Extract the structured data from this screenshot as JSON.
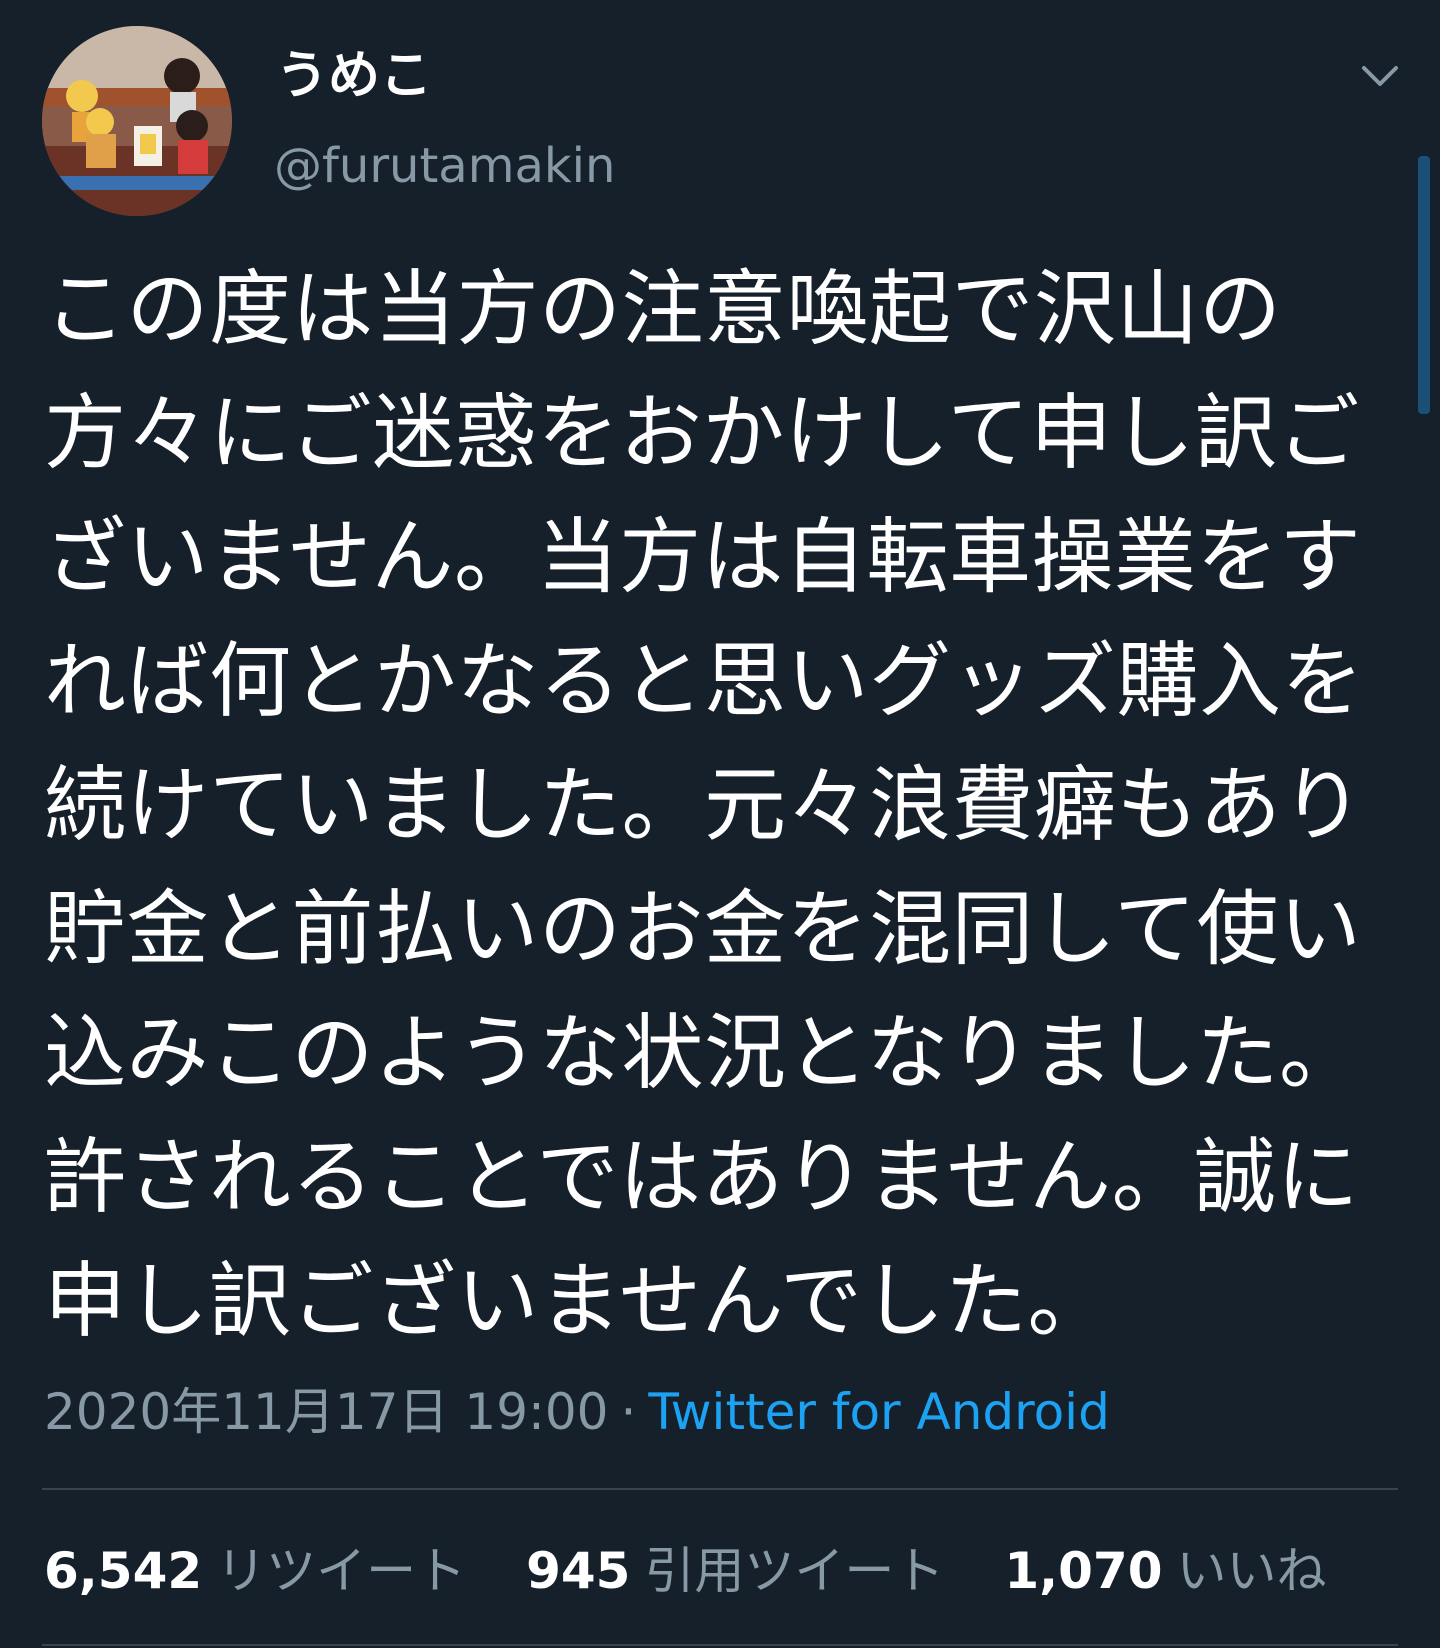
{
  "user": {
    "display_name": "うめこ",
    "handle": "@furutamakin"
  },
  "tweet": {
    "text": "この度は当方の注意喚起で沢山の方々にご迷惑をおかけして申し訳ございません。当方は自転車操業をすれば何とかなると思いグッズ購入を続けていました。元々浪費癖もあり貯金と前払いのお金を混同して使い込みこのような状況となりました。許されることではありません。誠に申し訳ございませんでした。",
    "timestamp": "2020年11月17日 19:00",
    "separator": "·",
    "source": "Twitter for Android"
  },
  "stats": {
    "retweets_count": "6,542",
    "retweets_label": "リツイート",
    "quotes_count": "945",
    "quotes_label": "引用ツイート",
    "likes_count": "1,070",
    "likes_label": "いいね"
  },
  "icons": {
    "menu": "chevron-down-icon",
    "avatar": "avatar-image"
  },
  "colors": {
    "background": "#15202b",
    "text": "#ffffff",
    "secondary": "#8899a6",
    "link": "#1da1f2",
    "divider": "#38444d"
  }
}
